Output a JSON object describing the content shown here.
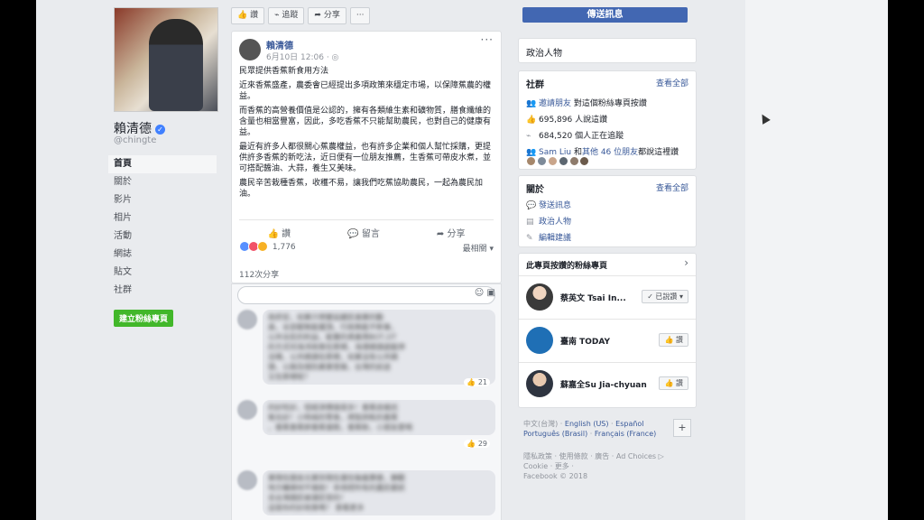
{
  "profile": {
    "name": "賴清德",
    "handle": "@chingte"
  },
  "left_nav": [
    "首頁",
    "關於",
    "影片",
    "相片",
    "活動",
    "網誌",
    "貼文",
    "社群"
  ],
  "create_page": "建立粉絲專頁",
  "toolbar": {
    "like": "讚",
    "follow": "追蹤",
    "share": "分享",
    "more": "···",
    "send_message": "傳送訊息"
  },
  "post": {
    "author": "賴清德",
    "time": "6月10日 12:06 · ◎",
    "paragraphs": [
      "民眾提供香蕉新食用方法",
      "近來香蕉盛產，農委會已經提出多項政策來穩定市場，以保障蕉農的權益。",
      "而香蕉的高營養價值是公認的，擁有各類維生素和礦物質，膳食纖維的含量也相當豐富，因此，多吃香蕉不只能幫助農民，也對自己的健康有益。",
      "最近有許多人都很關心蕉農權益，也有許多企業和個人幫忙採購，更提供許多香蕉的新吃法，近日便有一位朋友推薦，生香蕉可帶皮水煮，並可搭配醬油、大蒜，養生又美味。",
      "農民辛苦栽種香蕉，收穫不易，讓我們吃蕉協助農民，一起為農民加油。"
    ],
    "actions": [
      "讚",
      "留言",
      "分享"
    ],
    "reaction_count": "1,776",
    "most_relevant": "最相關 ▾",
    "shares": "112次分享"
  },
  "comments": [
    {
      "text_lines": [
        "政府官，如果只想要延續民進黨的動",
        "員，全部都無能擺頂，行政無能不幹事，",
        "公共全民的利益，能實的資產用BOT,OT",
        "的方式何海洋政策在那裡，海港碼頭遊艇停",
        "泊場，公共碼頭在那裡，如果沒有公共碼",
        "頭，公路及個別產業發展，台灣的前途",
        "又在那裡呢？"
      ],
      "likes": "21"
    },
    {
      "text_lines": [
        "的好吃好，但經濟價值很多！香蕉皮維抗",
        "氧化好！小時候的零食，烤製烘乾的香蕉",
        "，香蕉香蕉餅香蕉蛋糕，香蕉粉，小朋友愛喝"
      ],
      "likes": "29"
    },
    {
      "text_lines": [
        "黨現在國金光黨到現在還在裝瘋賣傻，靜觀",
        "地方輔導材不撥款！非得把所有的農民都抓",
        "去台灣國民被選民受的！",
        "這是你的好政策嗎？ 查看更多"
      ],
      "likes": ""
    }
  ],
  "category": "政治人物",
  "community": {
    "title": "社群",
    "see_all": "查看全部",
    "invite": "邀請朋友",
    "invite_suffix": "對這個粉絲專頁按讚",
    "likes": "695,896 人說這讚",
    "follows": "684,520 個人正在追蹤",
    "friends_prefix": "Sam Liu",
    "friends_mid": " 和",
    "friends_more": "其他 46 位朋友",
    "friends_suffix": "都說這裡讚"
  },
  "about": {
    "title": "關於",
    "see_all": "查看全部",
    "send_message": "發送訊息",
    "category": "政治人物",
    "suggest_edit": "編輯建議"
  },
  "liked_pages": {
    "title": "此專頁按讚的粉絲專頁",
    "chevron": "›",
    "pages": [
      {
        "name": "蔡英文 Tsai In...",
        "button": "✓ 已說讚 ▾"
      },
      {
        "name": "臺南 TODAY",
        "button": "讚"
      },
      {
        "name": "蘇嘉全Su Jia-chyuan",
        "button": "讚"
      }
    ]
  },
  "languages": {
    "current": "中文(台灣)",
    "options": [
      "English (US)",
      "Español",
      "Português (Brasil)",
      "Français (France)"
    ],
    "plus": "+"
  },
  "footer": {
    "line1": "隱私政策 · 使用條款 · 廣告 · Ad Choices ▷",
    "line2": "Cookie · 更多 ·",
    "line3": "Facebook © 2018"
  }
}
